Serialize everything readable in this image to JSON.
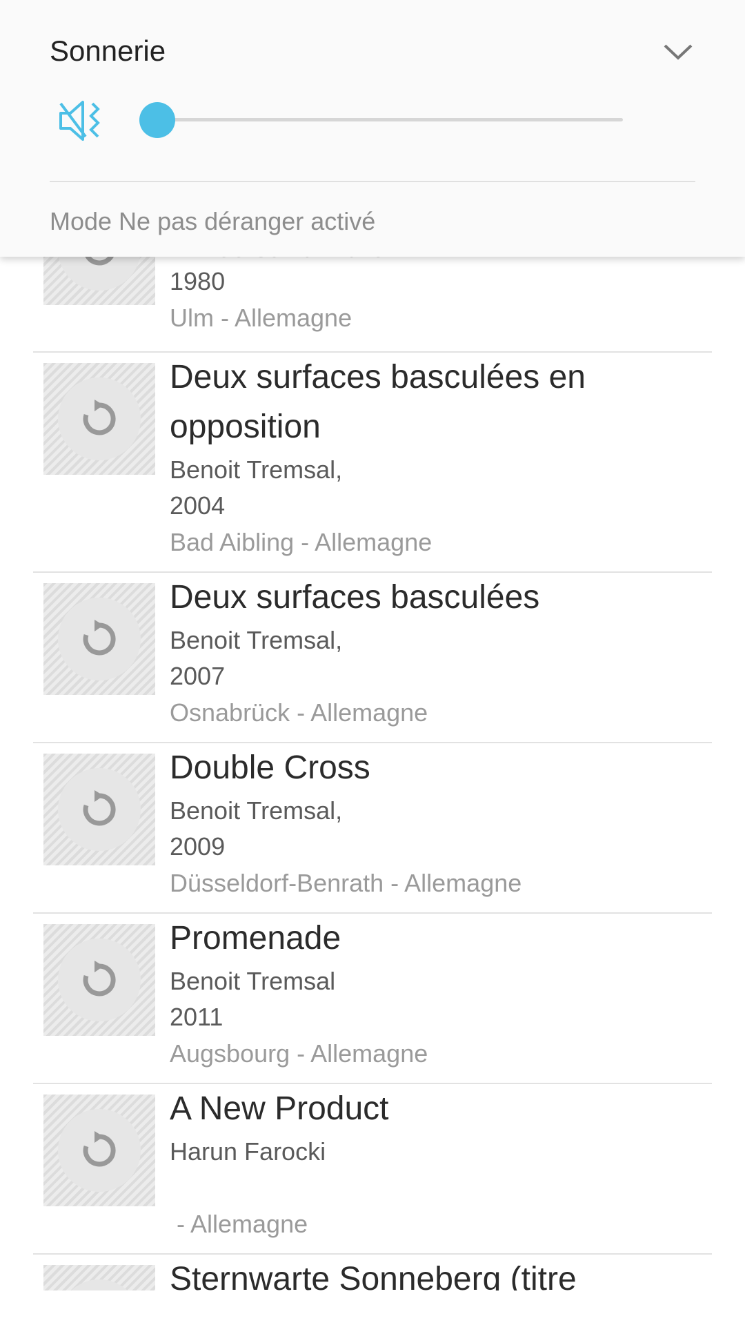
{
  "volume_panel": {
    "title": "Sonnerie",
    "level": 0,
    "muted": true,
    "accent_color": "#4cbfe6",
    "icons": {
      "expand": "chevron-down-icon",
      "speaker": "speaker-muted-icon"
    },
    "dnd_status": "Mode Ne pas déranger activé"
  },
  "list": {
    "partial_top": {
      "title_fragment": "Niki de Saint Phalle",
      "year": "1980",
      "place": "Ulm - Allemagne"
    },
    "items": [
      {
        "title_line1": "Deux surfaces basculées en",
        "title_line2": "opposition",
        "author": "Benoit Tremsal,",
        "year": "2004",
        "place": "Bad Aibling - Allemagne"
      },
      {
        "title": "Deux surfaces basculées",
        "author": "Benoit Tremsal,",
        "year": "2007",
        "place": "Osnabrück - Allemagne"
      },
      {
        "title": "Double Cross",
        "author": "Benoit Tremsal,",
        "year": "2009",
        "place": "Düsseldorf-Benrath - Allemagne"
      },
      {
        "title": "Promenade",
        "author": "Benoit Tremsal",
        "year": "2011",
        "place": "Augsbourg - Allemagne"
      },
      {
        "title": "A New Product",
        "author": "Harun Farocki",
        "year": "",
        "place": " - Allemagne"
      }
    ],
    "partial_bottom": {
      "title_fragment": "Sternwarte Sonneberg (titre"
    },
    "thumbnail_icon": "reload-icon"
  }
}
